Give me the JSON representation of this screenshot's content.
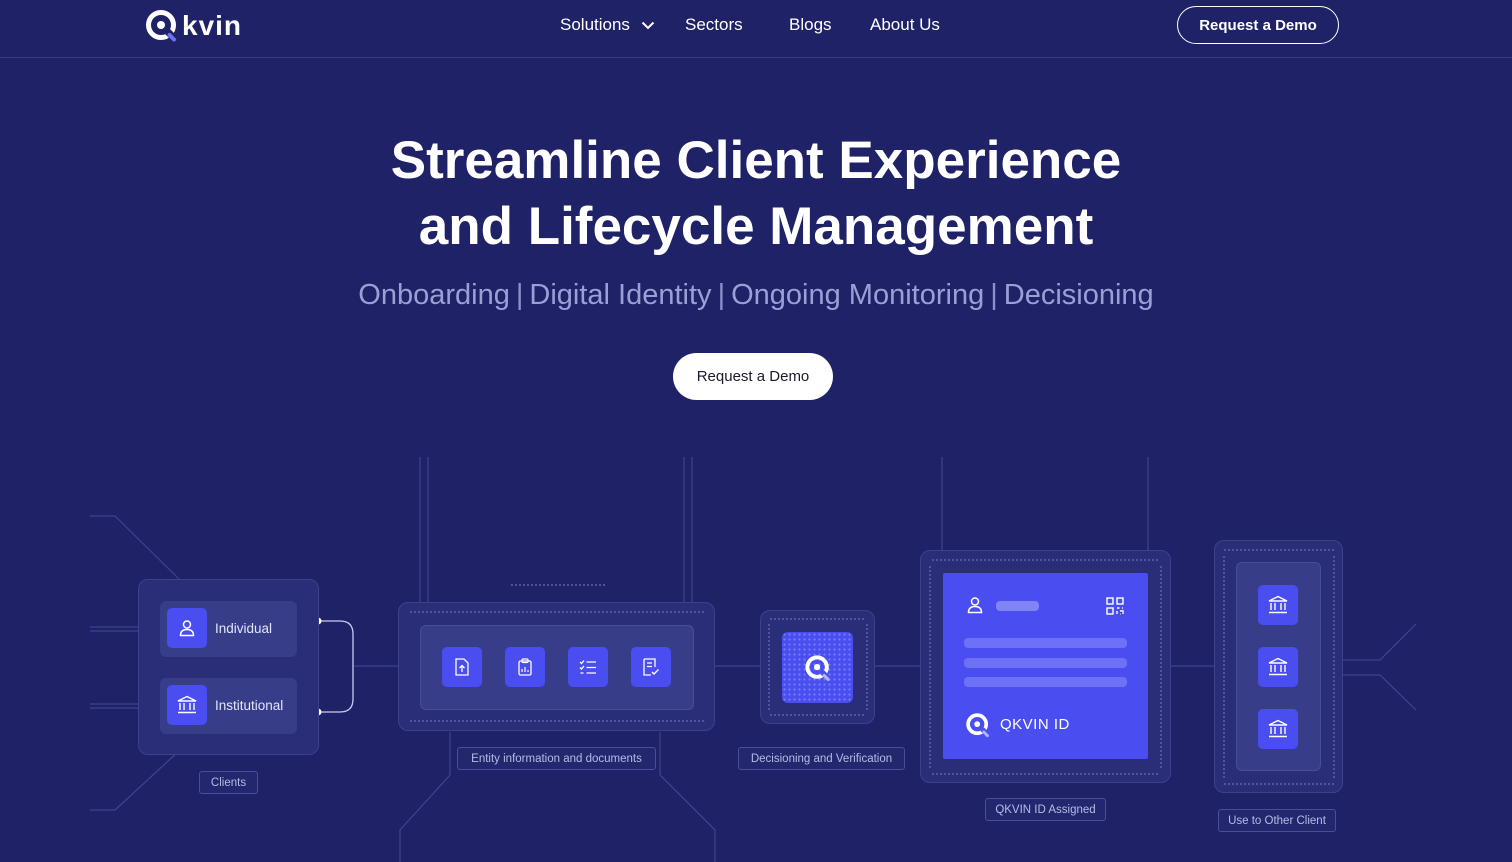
{
  "brand": {
    "logo_text": "kvin",
    "logo_icon": "qkvin-q-logo-icon"
  },
  "nav": {
    "items": [
      {
        "label": "Solutions",
        "has_dropdown": true
      },
      {
        "label": "Sectors"
      },
      {
        "label": "Blogs"
      },
      {
        "label": "About Us"
      }
    ],
    "cta_label": "Request a Demo"
  },
  "hero": {
    "title_line1": "Streamline Client Experience",
    "title_line2": "and Lifecycle Management",
    "subtitle_items": [
      "Onboarding",
      "Digital Identity",
      "Ongoing Monitoring",
      "Decisioning"
    ],
    "separator": "|",
    "cta_label": "Request a Demo"
  },
  "diagram": {
    "clients": {
      "items": [
        {
          "label": "Individual",
          "icon": "person-icon"
        },
        {
          "label": "Institutional",
          "icon": "bank-icon"
        }
      ],
      "tag": "Clients"
    },
    "entity": {
      "icons": [
        "file-upload-icon",
        "clipboard-icon",
        "checklist-icon",
        "document-check-icon"
      ],
      "tag": "Entity information and documents"
    },
    "decisioning": {
      "icon": "qkvin-logo-icon",
      "tag": "Decisioning and Verification"
    },
    "qkvin_id": {
      "card_label": "QKVIN ID",
      "tag": "QKVIN ID Assigned"
    },
    "other_client": {
      "icons": [
        "bank-icon",
        "bank-icon",
        "bank-icon"
      ],
      "tag": "Use to Other Client"
    }
  },
  "colors": {
    "background": "#1f2266",
    "accent": "#4a4ef0",
    "subtitle": "#9c9fd6",
    "panel": "#2a2e78"
  }
}
